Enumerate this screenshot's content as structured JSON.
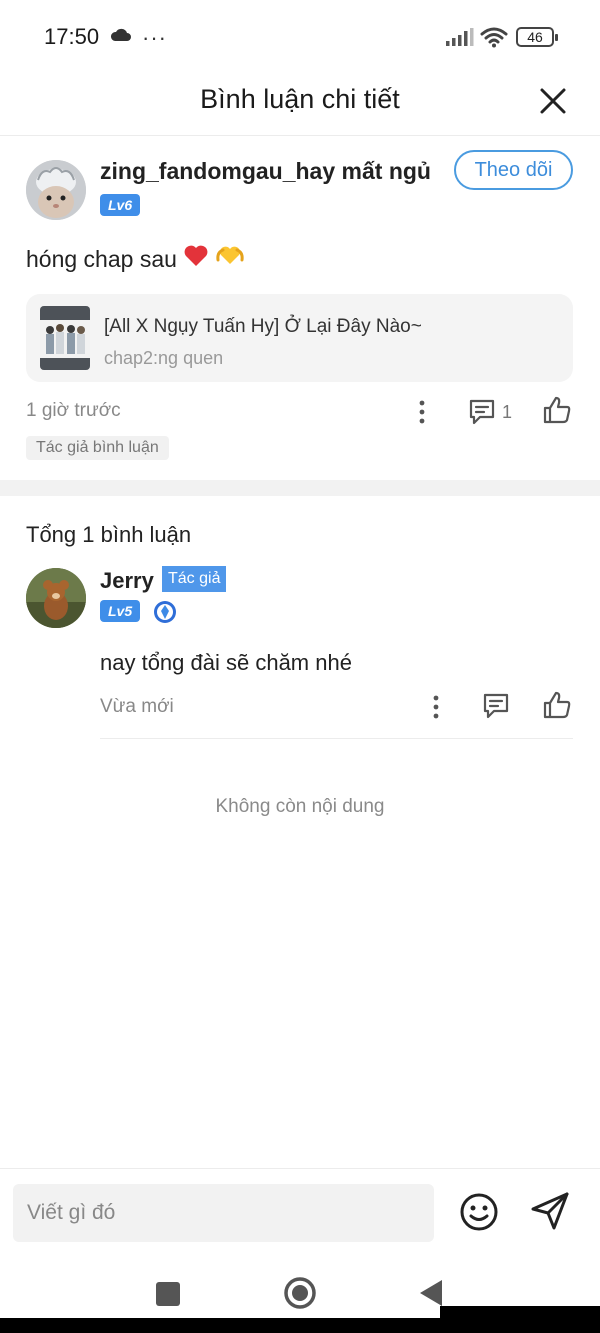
{
  "status_bar": {
    "time": "17:50",
    "battery": "46",
    "icons": [
      "cloud-icon",
      "more-dots-icon",
      "signal-icon",
      "wifi-icon",
      "battery-icon"
    ]
  },
  "header": {
    "title": "Bình luận chi tiết",
    "close_icon": "close-icon"
  },
  "main_comment": {
    "username": "zing_fandomgau_hay mất ngủ",
    "level": "Lv6",
    "follow_label": "Theo dõi",
    "text": "hóng chap sau",
    "emoji_icons": [
      "heart-icon",
      "heart-hands-icon"
    ],
    "work": {
      "title": "[All X Ngụy Tuấn Hy] Ở Lại Đây Nào~",
      "chapter": "chap2:ng quen"
    },
    "time": "1 giờ trước",
    "reply_count": "1",
    "author_tag": "Tác giả bình luận"
  },
  "replies_section": {
    "total_label": "Tổng 1 bình luận",
    "items": [
      {
        "username": "Jerry",
        "author_badge": "Tác giả",
        "level": "Lv5",
        "text": "nay tổng đài sẽ chăm nhé",
        "time": "Vừa mới"
      }
    ],
    "end_text": "Không còn nội dung"
  },
  "input_bar": {
    "placeholder": "Viết gì đó"
  },
  "colors": {
    "accent_blue": "#3f8ee9",
    "follow_border": "#4a9be0",
    "muted_text": "#888888",
    "card_bg": "#f4f4f4",
    "separator": "#f2f2f2"
  }
}
